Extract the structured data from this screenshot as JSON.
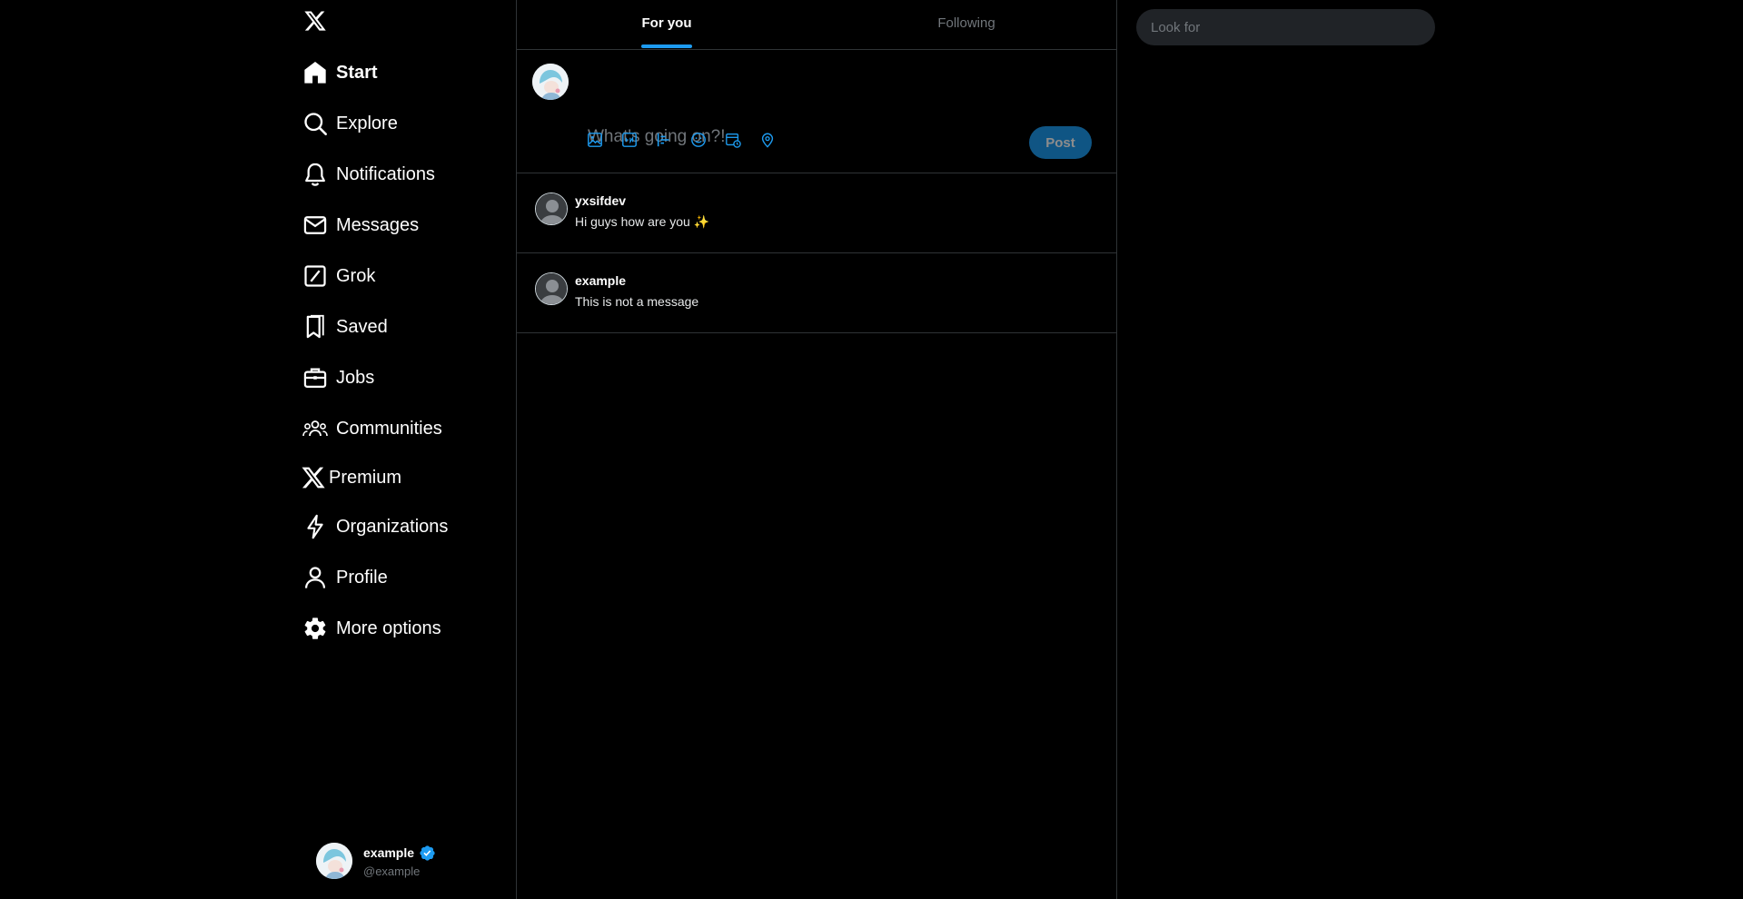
{
  "colors": {
    "background": "#000000",
    "accent": "#1d9bf0",
    "text_primary": "#ffffff",
    "text_secondary": "#71767b",
    "border": "#2f3336",
    "search_bg": "#202327"
  },
  "logo": {
    "icon": "x-logo-icon"
  },
  "sidebar": {
    "items": [
      {
        "label": "Start",
        "icon": "home-icon",
        "active": true
      },
      {
        "label": "Explore",
        "icon": "search-icon"
      },
      {
        "label": "Notifications",
        "icon": "bell-icon"
      },
      {
        "label": "Messages",
        "icon": "mail-icon"
      },
      {
        "label": "Grok",
        "icon": "grok-icon"
      },
      {
        "label": "Saved",
        "icon": "bookmark-icon"
      },
      {
        "label": "Jobs",
        "icon": "briefcase-icon"
      },
      {
        "label": "Communities",
        "icon": "people-icon"
      },
      {
        "label": "Premium",
        "icon": "x-logo-icon"
      },
      {
        "label": "Organizations",
        "icon": "lightning-icon"
      },
      {
        "label": "Profile",
        "icon": "person-icon"
      },
      {
        "label": "More options",
        "icon": "gear-icon"
      }
    ]
  },
  "account": {
    "name": "example",
    "handle": "@example",
    "verified": true
  },
  "tabs": [
    {
      "label": "For you",
      "active": true
    },
    {
      "label": "Following",
      "active": false
    }
  ],
  "composer": {
    "placeholder": "What's going on?!",
    "value": "",
    "post_label": "Post",
    "tools": [
      "image-icon",
      "gif-icon",
      "poll-icon",
      "emoji-icon",
      "schedule-icon",
      "location-icon"
    ]
  },
  "posts": [
    {
      "author": "yxsifdev",
      "text": "Hi guys how are you ✨"
    },
    {
      "author": "example",
      "text": "This is not a message"
    }
  ],
  "search": {
    "placeholder": "Look for",
    "value": ""
  }
}
